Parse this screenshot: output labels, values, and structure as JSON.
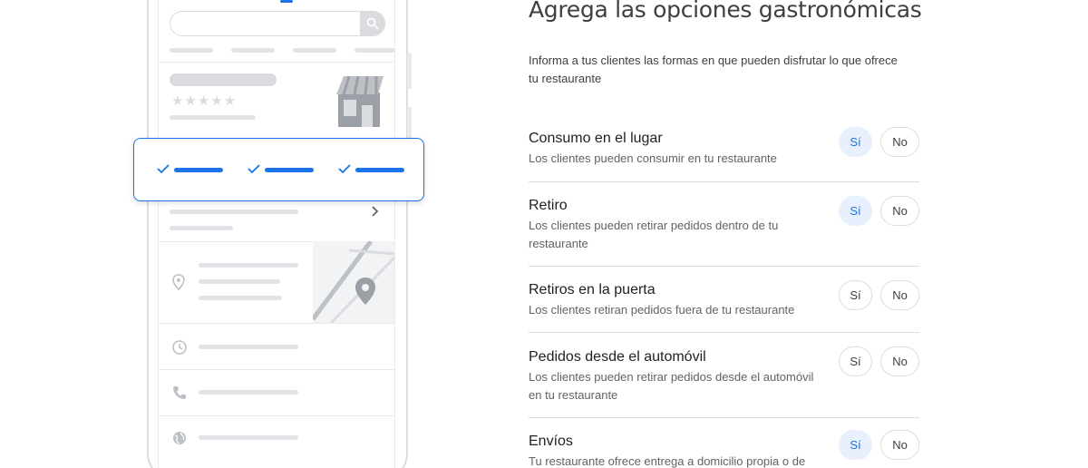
{
  "page": {
    "title": "Agrega las opciones gastronómicas",
    "intro": "Informa a tus clientes las formas en que pueden disfrutar lo que ofrece tu restaurante"
  },
  "options": [
    {
      "title": "Consumo en el lugar",
      "description": "Los clientes pueden consumir en tu restaurante",
      "yes": "Sí",
      "no": "No",
      "selected": "yes"
    },
    {
      "title": "Retiro",
      "description": "Los clientes pueden retirar pedidos dentro de tu restaurante",
      "yes": "Sí",
      "no": "No",
      "selected": "yes"
    },
    {
      "title": "Retiros en la puerta",
      "description": "Los clientes retiran pedidos fuera de tu restaurante",
      "yes": "Sí",
      "no": "No",
      "selected": "none"
    },
    {
      "title": "Pedidos desde el automóvil",
      "description": "Los clientes pueden retirar pedidos desde el automóvil en tu restaurante",
      "yes": "Sí",
      "no": "No",
      "selected": "none"
    },
    {
      "title": "Envíos",
      "description": "Tu restaurante ofrece entrega a domicilio propia o de",
      "yes": "Sí",
      "no": "No",
      "selected": "yes"
    }
  ],
  "illustration": {
    "rating_stars": "★★★★★",
    "icons": [
      "search-icon",
      "store-awning-icon",
      "chevron-right-icon",
      "location-pin-icon",
      "map-pin-icon",
      "clock-icon",
      "phone-icon",
      "globe-icon",
      "check-icon"
    ]
  },
  "colors": {
    "accent": "#1a73e8",
    "selected_chip_bg": "#e8f0fe",
    "placeholder_gray": "#dadce0"
  }
}
